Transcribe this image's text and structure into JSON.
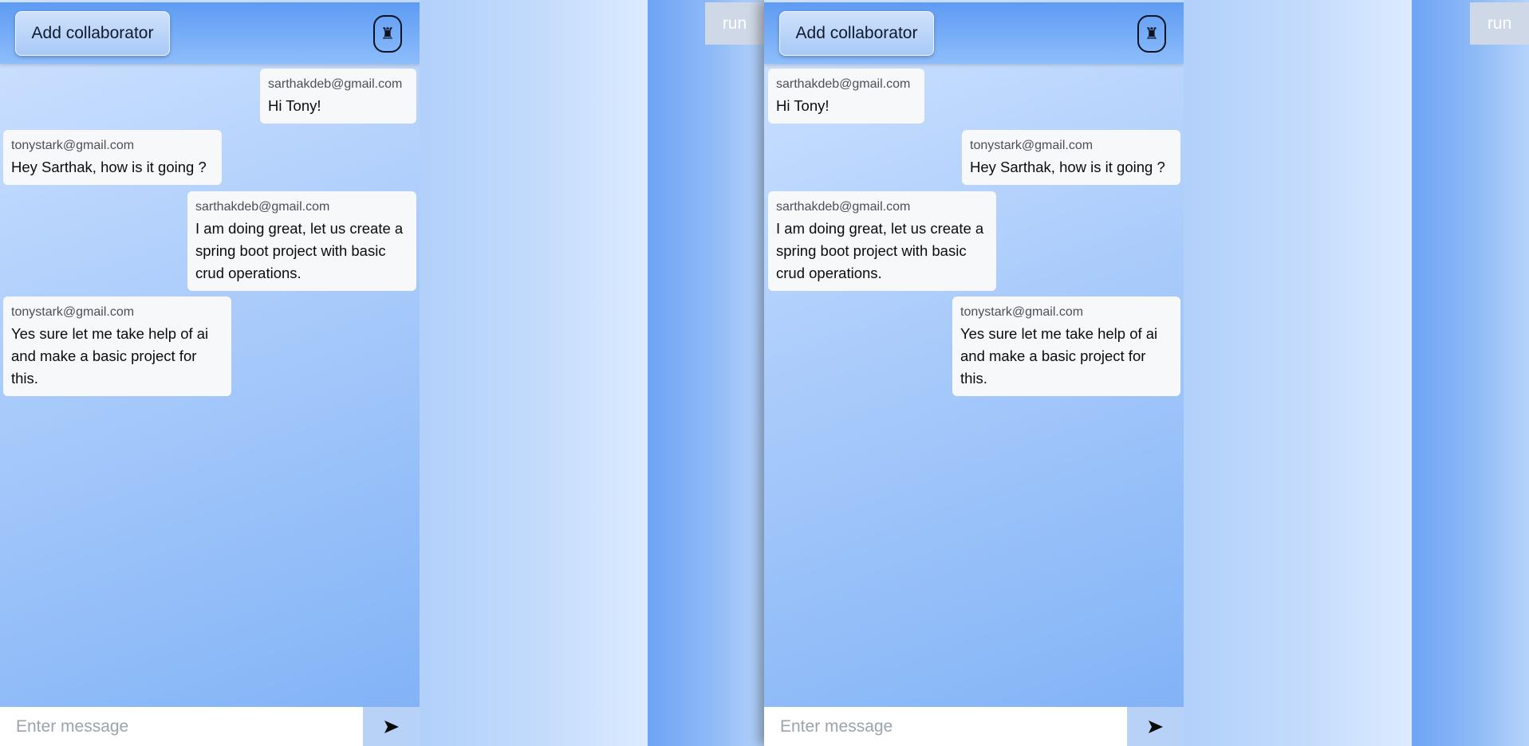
{
  "windows": [
    {
      "header": {
        "add_collaborator_label": "Add collaborator",
        "people_icon": "♜"
      },
      "messages": [
        {
          "sender": "sarthakdeb@gmail.com",
          "text": "Hi Tony!"
        },
        {
          "sender": "tonystark@gmail.com",
          "text": "Hey Sarthak, how is it going ?"
        },
        {
          "sender": "sarthakdeb@gmail.com",
          "text": "I am doing great, let us create a spring boot project with basic crud operations."
        },
        {
          "sender": "tonystark@gmail.com",
          "text": "Yes sure let me take help of ai and make a basic project for this."
        }
      ],
      "composer": {
        "placeholder": "Enter message",
        "send_icon": "send-icon"
      },
      "run_label": "run"
    },
    {
      "header": {
        "add_collaborator_label": "Add collaborator",
        "people_icon": "♜"
      },
      "messages": [
        {
          "sender": "sarthakdeb@gmail.com",
          "text": "Hi Tony!"
        },
        {
          "sender": "tonystark@gmail.com",
          "text": "Hey Sarthak, how is it going ?"
        },
        {
          "sender": "sarthakdeb@gmail.com",
          "text": "I am doing great, let us create a spring boot project with basic crud operations."
        },
        {
          "sender": "tonystark@gmail.com",
          "text": "Yes sure let me take help of ai and make a basic project for this."
        }
      ],
      "composer": {
        "placeholder": "Enter message",
        "send_icon": "send-icon"
      },
      "run_label": "run"
    }
  ]
}
